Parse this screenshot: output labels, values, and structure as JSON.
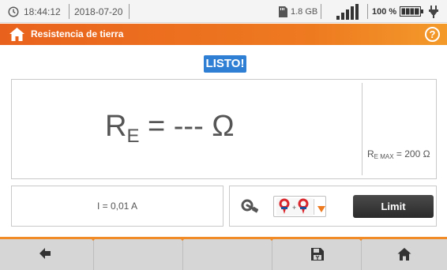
{
  "status_bar": {
    "time": "18:44:12",
    "date": "2018-07-20",
    "storage": "1.8 GB",
    "battery_percent": "100 %",
    "signal_level": 4,
    "icons": [
      "clock-icon",
      "sd-card-icon",
      "signal-icon",
      "battery-icon",
      "power-plug-icon"
    ]
  },
  "title_bar": {
    "title": "Resistencia de tierra",
    "left_icon": "home-icon",
    "right_icon": "help-icon",
    "help_label": "?"
  },
  "status_badge": "LISTO!",
  "result": {
    "symbol": "R",
    "subscript": "E",
    "equals_value": " = --- Ω",
    "max_symbol": "R",
    "max_subscript": "E MAX",
    "max_value": " = 200 Ω"
  },
  "current": {
    "text": "I = 0,01 A"
  },
  "controls": {
    "clamp_icon": "clamp-probe-icon",
    "mode_selector_icons": [
      "probe-icon",
      "plus",
      "probe-icon"
    ],
    "limit_label": "Limit"
  },
  "bottom_nav": {
    "buttons": [
      "back-arrow-icon",
      "",
      "",
      "save-icon",
      "home-icon"
    ]
  },
  "colors": {
    "accent": "#ee7a20",
    "badge": "#2f7fd4",
    "button_dark": "#333333",
    "probe_red": "#d9262c"
  }
}
